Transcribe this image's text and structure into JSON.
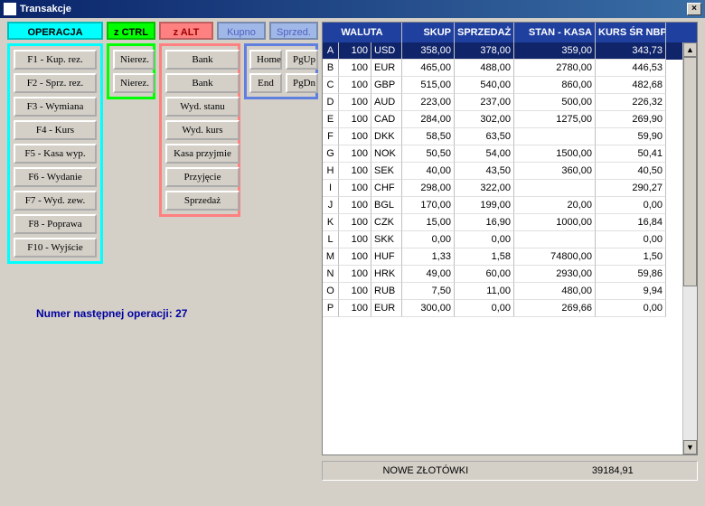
{
  "window": {
    "title": "Transakcje",
    "close_glyph": "×"
  },
  "headers": {
    "operacja": "OPERACJA",
    "ctrl": "z CTRL",
    "alt": "z ALT",
    "kupno": "Kupno",
    "sprzed": "Sprzed."
  },
  "buttons": {
    "op": [
      "F1 - Kup. rez.",
      "F2 - Sprz. rez.",
      "F3 - Wymiana",
      "F4 - Kurs",
      "F5 - Kasa wyp.",
      "F6 - Wydanie",
      "F7 - Wyd. zew.",
      "F8 - Poprawa",
      "F10 - Wyjście"
    ],
    "ctrl": [
      "Nierez.",
      "Nierez."
    ],
    "alt": [
      "Bank",
      "Bank",
      "Wyd. stanu",
      "Wyd. kurs",
      "Kasa przyjmie",
      "Przyjęcie",
      "Sprzedaż"
    ],
    "nav": [
      "Home",
      "PgUp",
      "End",
      "PgDn"
    ]
  },
  "status": {
    "next_op_label": "Numer następnej operacji:",
    "next_op_value": "27"
  },
  "table": {
    "columns": [
      "WALUTA",
      "SKUP",
      "SPRZEDAŻ",
      "STAN - KASA",
      "KURS ŚR NBP"
    ],
    "rows": [
      {
        "k": "A",
        "amt": "100",
        "cur": "USD",
        "skup": "358,00",
        "sprz": "378,00",
        "stan": "359,00",
        "nbp": "343,73",
        "sel": true
      },
      {
        "k": "B",
        "amt": "100",
        "cur": "EUR",
        "skup": "465,00",
        "sprz": "488,00",
        "stan": "2780,00",
        "nbp": "446,53"
      },
      {
        "k": "C",
        "amt": "100",
        "cur": "GBP",
        "skup": "515,00",
        "sprz": "540,00",
        "stan": "860,00",
        "nbp": "482,68"
      },
      {
        "k": "D",
        "amt": "100",
        "cur": "AUD",
        "skup": "223,00",
        "sprz": "237,00",
        "stan": "500,00",
        "nbp": "226,32"
      },
      {
        "k": "E",
        "amt": "100",
        "cur": "CAD",
        "skup": "284,00",
        "sprz": "302,00",
        "stan": "1275,00",
        "nbp": "269,90"
      },
      {
        "k": "F",
        "amt": "100",
        "cur": "DKK",
        "skup": "58,50",
        "sprz": "63,50",
        "stan": "",
        "nbp": "59,90"
      },
      {
        "k": "G",
        "amt": "100",
        "cur": "NOK",
        "skup": "50,50",
        "sprz": "54,00",
        "stan": "1500,00",
        "nbp": "50,41"
      },
      {
        "k": "H",
        "amt": "100",
        "cur": "SEK",
        "skup": "40,00",
        "sprz": "43,50",
        "stan": "360,00",
        "nbp": "40,50"
      },
      {
        "k": "I",
        "amt": "100",
        "cur": "CHF",
        "skup": "298,00",
        "sprz": "322,00",
        "stan": "",
        "nbp": "290,27"
      },
      {
        "k": "J",
        "amt": "100",
        "cur": "BGL",
        "skup": "170,00",
        "sprz": "199,00",
        "stan": "20,00",
        "nbp": "0,00"
      },
      {
        "k": "K",
        "amt": "100",
        "cur": "CZK",
        "skup": "15,00",
        "sprz": "16,90",
        "stan": "1000,00",
        "nbp": "16,84"
      },
      {
        "k": "L",
        "amt": "100",
        "cur": "SKK",
        "skup": "0,00",
        "sprz": "0,00",
        "stan": "",
        "nbp": "0,00"
      },
      {
        "k": "M",
        "amt": "100",
        "cur": "HUF",
        "skup": "1,33",
        "sprz": "1,58",
        "stan": "74800,00",
        "nbp": "1,50"
      },
      {
        "k": "N",
        "amt": "100",
        "cur": "HRK",
        "skup": "49,00",
        "sprz": "60,00",
        "stan": "2930,00",
        "nbp": "59,86"
      },
      {
        "k": "O",
        "amt": "100",
        "cur": "RUB",
        "skup": "7,50",
        "sprz": "11,00",
        "stan": "480,00",
        "nbp": "9,94"
      },
      {
        "k": "P",
        "amt": "100",
        "cur": "EUR",
        "skup": "300,00",
        "sprz": "0,00",
        "stan": "269,66",
        "nbp": "0,00"
      }
    ]
  },
  "bottombar": {
    "label": "NOWE ZŁOTÓWKI",
    "value": "39184,91"
  }
}
